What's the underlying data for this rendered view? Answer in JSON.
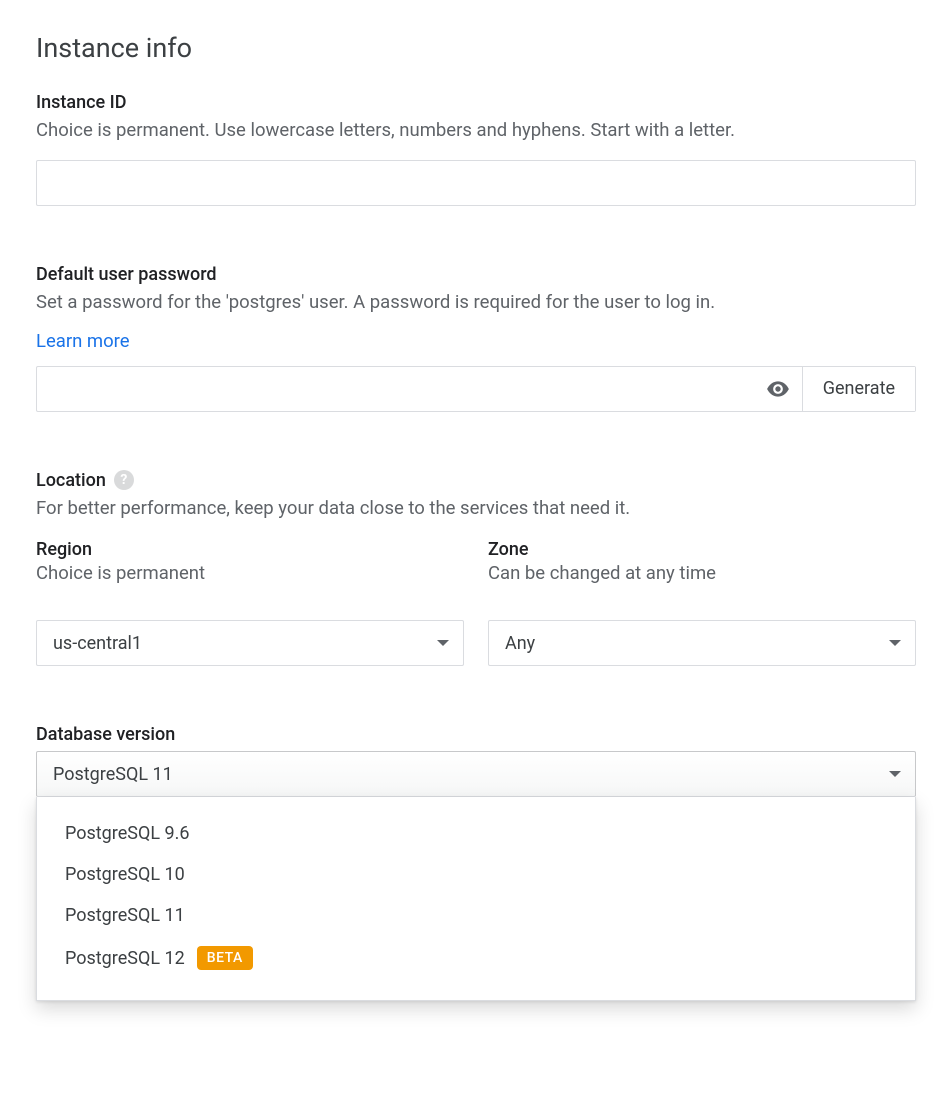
{
  "section_title": "Instance info",
  "instance_id": {
    "label": "Instance ID",
    "help": "Choice is permanent. Use lowercase letters, numbers and hyphens. Start with a letter.",
    "value": ""
  },
  "password": {
    "label": "Default user password",
    "help": "Set a password for the 'postgres' user. A password is required for the user to log in.",
    "learn_more": "Learn more",
    "value": "",
    "toggle_icon": "eye-icon",
    "generate_label": "Generate"
  },
  "location": {
    "label": "Location",
    "help_icon": "help-icon",
    "help_glyph": "?",
    "help": "For better performance, keep your data close to the services that need it.",
    "region": {
      "label": "Region",
      "help": "Choice is permanent",
      "value": "us-central1"
    },
    "zone": {
      "label": "Zone",
      "help": "Can be changed at any time",
      "value": "Any"
    }
  },
  "db_version": {
    "label": "Database version",
    "value": "PostgreSQL 11",
    "options": [
      {
        "label": "PostgreSQL 9.6",
        "badge": ""
      },
      {
        "label": "PostgreSQL 10",
        "badge": ""
      },
      {
        "label": "PostgreSQL 11",
        "badge": ""
      },
      {
        "label": "PostgreSQL 12",
        "badge": "BETA"
      }
    ]
  }
}
